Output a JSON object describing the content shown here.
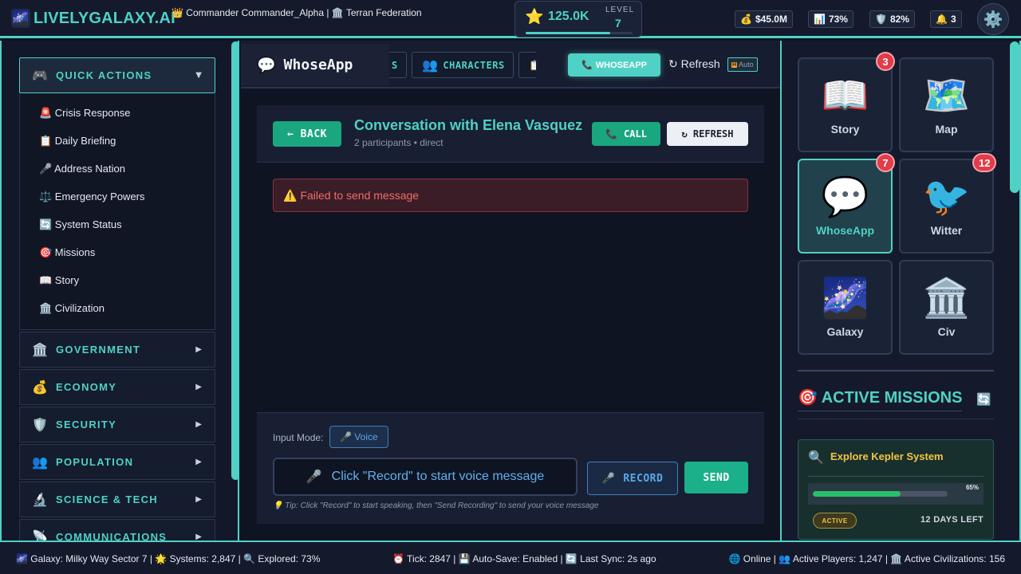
{
  "topbar": {
    "logo_icon": "🌌",
    "logo_text": "LIVELYGALAXY.AI",
    "commander": "👑 Commander Commander_Alpha | 🏛️ Terran Federation",
    "score_icon": "⭐",
    "score": "125.0K",
    "level_label": "LEVEL",
    "level": "7",
    "xp_progress_percent": 79,
    "stats": [
      {
        "icon": "💰",
        "value": "$45.0M"
      },
      {
        "icon": "📊",
        "value": "73%"
      },
      {
        "icon": "🛡️",
        "value": "82%"
      },
      {
        "icon": "🔔",
        "value": "3"
      }
    ],
    "settings_icon": "⚙️"
  },
  "sidebar": {
    "quick_actions": {
      "icon": "🎮",
      "label": "QUICK ACTIONS",
      "caret": "▼",
      "items": [
        "🚨 Crisis Response",
        "📋 Daily Briefing",
        "🎤 Address Nation",
        "⚖️ Emergency Powers",
        "🔄 System Status",
        "🎯 Missions",
        "📖 Story",
        "🏛️ Civilization"
      ]
    },
    "sections": [
      {
        "icon": "🏛️",
        "label": "GOVERNMENT",
        "arrow": "▶"
      },
      {
        "icon": "💰",
        "label": "ECONOMY",
        "arrow": "▶"
      },
      {
        "icon": "🛡️",
        "label": "SECURITY",
        "arrow": "▶"
      },
      {
        "icon": "👥",
        "label": "POPULATION",
        "arrow": "▶"
      },
      {
        "icon": "🔬",
        "label": "SCIENCE & TECH",
        "arrow": "▶"
      },
      {
        "icon": "📡",
        "label": "COMMUNICATIONS",
        "arrow": "▶"
      }
    ]
  },
  "main": {
    "app_icon": "💬",
    "app_title": "WhoseApp",
    "tab_partial_left": "S",
    "tab_characters_icon": "👥",
    "tab_characters": "CHARACTERS",
    "tab_partial_right_icon": "📋",
    "active_tab_icon": "📞",
    "active_tab": "WHOSEAPP",
    "refresh": "↻ Refresh",
    "auto_icon": "🅷",
    "auto_label": "Auto",
    "conversation": {
      "back_label": "← BACK",
      "title": "Conversation with Elena Vasquez",
      "subtitle": "2 participants • direct",
      "call_icon": "📞",
      "call_label": "CALL",
      "refresh_label": "↻ REFRESH"
    },
    "error": {
      "icon": "⚠️",
      "text": "Failed to send message"
    },
    "composer": {
      "mode_label": "Input Mode:",
      "mode_icon": "🎤",
      "mode_value": "Voice",
      "input_icon": "🎤",
      "input_text": "Click \"Record\" to start voice message",
      "record_icon": "🎤",
      "record_label": "RECORD",
      "send_label": "SEND",
      "tip": "💡 Tip: Click \"Record\" to start speaking, then \"Send Recording\" to send your voice message"
    }
  },
  "right_panel": {
    "apps": [
      {
        "icon": "📖",
        "label": "Story",
        "badge": "3"
      },
      {
        "icon": "🗺️",
        "label": "Map",
        "badge": ""
      },
      {
        "icon": "💬",
        "label": "WhoseApp",
        "badge": "7"
      },
      {
        "icon": "🐦",
        "label": "Witter",
        "badge": "12"
      },
      {
        "icon": "🌌",
        "label": "Galaxy",
        "badge": ""
      },
      {
        "icon": "🏛️",
        "label": "Civ",
        "badge": ""
      }
    ],
    "missions_title": "🎯 ACTIVE MISSIONS",
    "missions_refresh_icon": "🔄",
    "mission": {
      "icon": "🔍",
      "title": "Explore Kepler System",
      "progress_percent": 65,
      "progress_label": "65%",
      "status": "ACTIVE",
      "days_left": "12 DAYS LEFT"
    }
  },
  "footer": {
    "left": "🌌 Galaxy: Milky Way Sector 7 | 🌟 Systems: 2,847 | 🔍 Explored: 73%",
    "center": "⏰ Tick: 2847 | 💾 Auto-Save: Enabled | 🔄 Last Sync: 2s ago",
    "right": "🌐 Online | 👥 Active Players: 1,247 | 🏛️ Active Civilizations: 156"
  },
  "colors": {
    "accent": "#4fd1c5",
    "success": "#1aa67f",
    "danger": "#e23b4a",
    "gold": "#f6c343",
    "background": "#0f1424"
  }
}
